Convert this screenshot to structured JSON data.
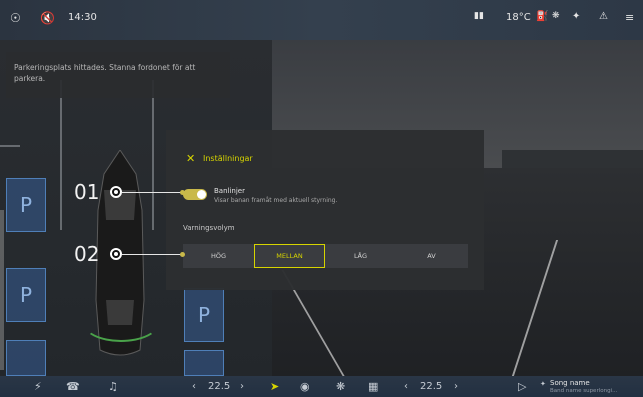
{
  "status_bar": {
    "time": "14:30",
    "temperature": "18°C",
    "user_icon": "user-icon",
    "mute_icon": "speaker-mute-icon",
    "signal_icon": "signal-icon",
    "ev_icon": "ev-station-icon",
    "fan_icon": "fan-icon",
    "bluetooth_icon": "bluetooth-icon",
    "notification_icon": "bell-icon",
    "menu_icon": "settings-sliders-icon"
  },
  "toast": {
    "message": "Parkeringsplats hittades. Stanna fordonet för att parkera."
  },
  "map": {
    "slot_label": "P"
  },
  "dialog": {
    "title": "Inställningar",
    "close_icon": "close-icon",
    "lane_lines": {
      "title": "Banlinjer",
      "description": "Visar banan framåt med aktuell styrning.",
      "enabled": true
    },
    "warning_volume": {
      "title": "Varningsvolym",
      "options": [
        "HÖG",
        "MELLAN",
        "LÅG",
        "AV"
      ],
      "selected": "MELLAN"
    }
  },
  "callouts": [
    "01",
    "02"
  ],
  "bottom_bar": {
    "left_temp": "22.5",
    "right_temp": "22.5",
    "lightning_icon": "lightning-icon",
    "phone_icon": "phone-icon",
    "music_icon": "music-note-icon",
    "navigation_icon": "navigation-arrow-icon",
    "car_icon": "car-icon",
    "fan_icon": "fan-icon",
    "apps_icon": "apps-grid-icon",
    "play_icon": "play-icon",
    "bluetooth_icon": "bluetooth-icon",
    "song": "Song name",
    "artist": "Band name superlongi..."
  },
  "colors": {
    "accent": "#d6d400",
    "toggle_track": "#c9b94a",
    "parking_slot": "#365c96"
  }
}
